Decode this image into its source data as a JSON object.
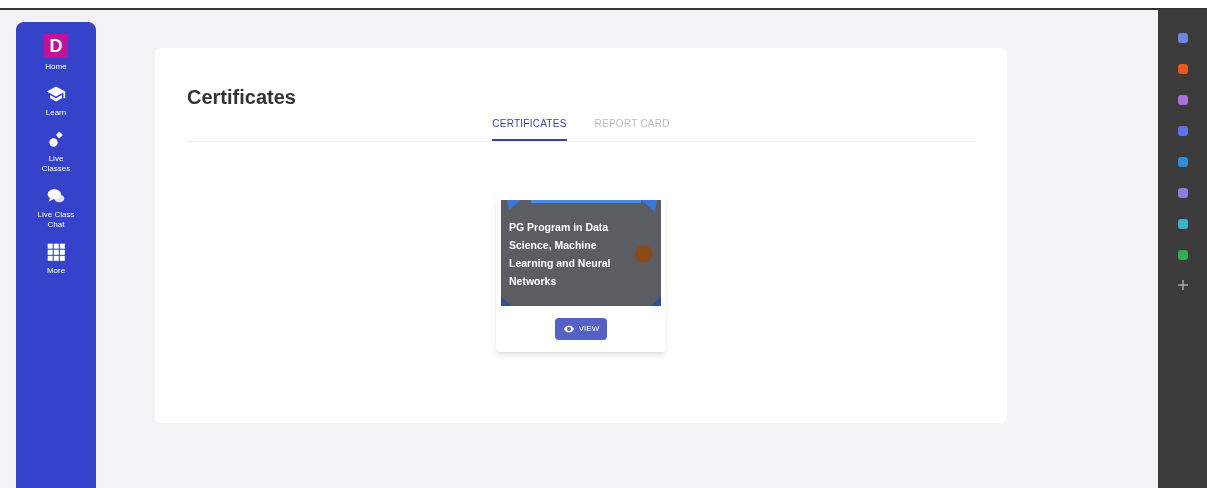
{
  "sidebar": {
    "logo": "D",
    "items": [
      {
        "kind": "home",
        "label": "Home"
      },
      {
        "kind": "learn",
        "label": "Learn"
      },
      {
        "kind": "live",
        "label": "Live Classes"
      },
      {
        "kind": "chat",
        "label": "Live Class Chat"
      },
      {
        "kind": "more",
        "label": "More"
      }
    ]
  },
  "page": {
    "title": "Certificates",
    "tabs": [
      {
        "label": "CERTIFICATES",
        "selected": true
      },
      {
        "label": "REPORT CARD",
        "selected": false
      }
    ]
  },
  "certificates": [
    {
      "title": "PG Program in Data Science, Machine Learning and Neural Networks",
      "button": "VIEW"
    }
  ]
}
